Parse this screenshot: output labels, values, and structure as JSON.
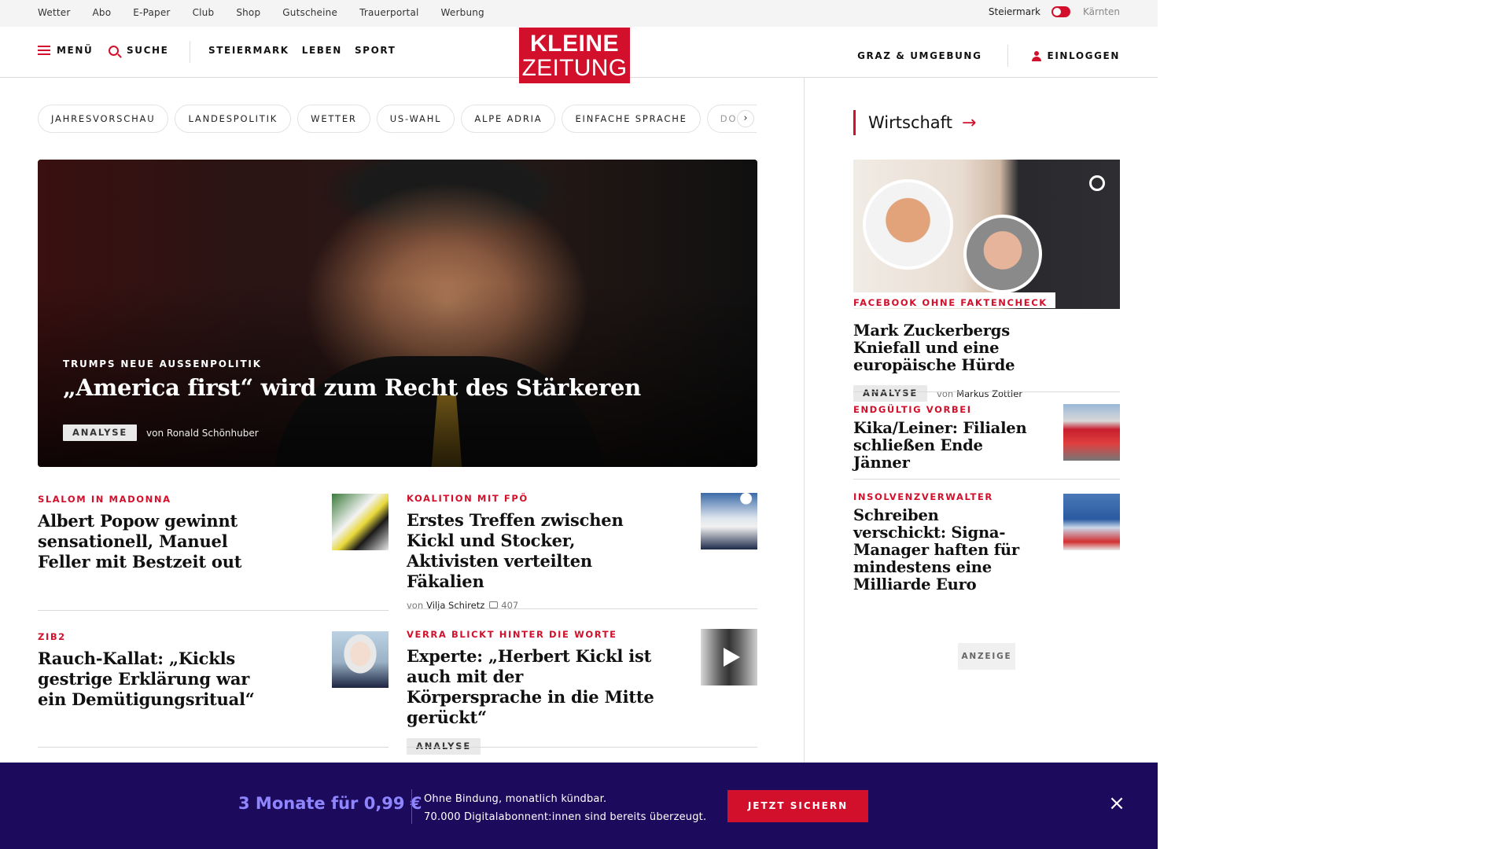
{
  "topbar": {
    "links": [
      "Wetter",
      "Abo",
      "E-Paper",
      "Club",
      "Shop",
      "Gutscheine",
      "Trauerportal",
      "Werbung"
    ],
    "region_active": "Steiermark",
    "region_inactive": "Kärnten"
  },
  "header": {
    "menu_label": "MENÜ",
    "search_label": "SUCHE",
    "sections": [
      "STEIERMARK",
      "LEBEN",
      "SPORT"
    ],
    "logo_line1": "KLEINE",
    "logo_line2": "ZEITUNG",
    "local_label": "GRAZ & UMGEBUNG",
    "login_label": "EINLOGGEN"
  },
  "tags": [
    "JAHRESVORSCHAU",
    "LANDESPOLITIK",
    "WETTER",
    "US-WAHL",
    "ALPE ADRIA",
    "EINFACHE SPRACHE",
    "DOS"
  ],
  "tags_next": "›",
  "hero": {
    "kicker": "TRUMPS NEUE AUSSENPOLITIK",
    "title": "„America first“ wird zum Recht des Stärkeren",
    "badge": "ANALYSE",
    "byline": "von Ronald Schönhuber"
  },
  "teasers": [
    {
      "kicker": "SLALOM IN MADONNA",
      "title": "Albert Popow gewinnt sensationell, Manuel Feller mit Bestzeit out"
    },
    {
      "kicker": "KOALITION MIT FPÖ",
      "title": "Erstes Treffen zwischen Kickl und Stocker, Aktivisten verteilten Fäkalien",
      "by": "von",
      "author": "Vilja Schiretz",
      "comments": "407"
    },
    {
      "kicker": "ZIB2",
      "title": "Rauch-Kallat: „Kickls gestrige Erklärung war ein Demütigungsritual“"
    },
    {
      "kicker": "VERRA BLICKT HINTER DIE WORTE",
      "title": "Experte: „Herbert Kickl ist auch mit der Körpersprache in die Mitte gerückt“",
      "badge": "ANALYSE"
    }
  ],
  "sidebar": {
    "heading": "Wirtschaft",
    "lead": {
      "kicker": "FACEBOOK OHNE FAKTENCHECK",
      "title": "Mark Zuckerbergs Kniefall und eine europäische Hürde",
      "badge": "ANALYSE",
      "by": "von",
      "author": "Markus Zottler"
    },
    "items": [
      {
        "kicker": "ENDGÜLTIG VORBEI",
        "title": "Kika/Leiner: Filialen schließen Ende Jänner"
      },
      {
        "kicker": "INSOLVENZVERWALTER",
        "title": "Schreiben verschickt: Signa-Manager haften für mindestens eine Milliarde Euro"
      }
    ],
    "ad_label": "ANZEIGE"
  },
  "promo": {
    "offer": "3 Monate für 0,99 €",
    "line1": "Ohne Bindung, monatlich kündbar.",
    "line2": "70.000 Digitalabonnent:innen sind bereits überzeugt.",
    "cta": "JETZT SICHERN",
    "close": "×"
  },
  "colors": {
    "brand_red": "#d2102b",
    "promo_bg": "#1c0a5c",
    "promo_accent": "#8f86ff"
  }
}
